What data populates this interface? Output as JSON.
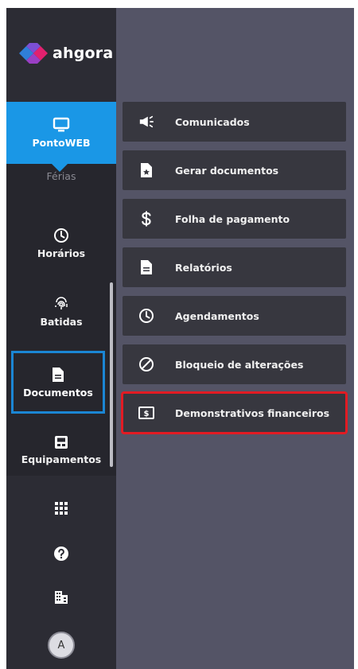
{
  "brand": {
    "name": "ahgora"
  },
  "nav": {
    "items": [
      {
        "label": "PontoWEB",
        "icon": "monitor-icon",
        "state": "active"
      },
      {
        "label": "Férias",
        "icon": "vacation-icon",
        "state": "dim"
      },
      {
        "label": "Horários",
        "icon": "clock-icon",
        "state": "normal"
      },
      {
        "label": "Batidas",
        "icon": "fingerprint-icon",
        "state": "normal"
      },
      {
        "label": "Documentos",
        "icon": "document-icon",
        "state": "focused"
      },
      {
        "label": "Equipamentos",
        "icon": "device-icon",
        "state": "normal"
      }
    ],
    "bottom": {
      "apps_icon": "grid-icon",
      "help_icon": "help-icon",
      "company_icon": "building-icon",
      "avatar_initial": "A"
    }
  },
  "submenu": {
    "items": [
      {
        "label": "Comunicados",
        "icon": "megaphone-icon"
      },
      {
        "label": "Gerar documentos",
        "icon": "document-star-icon"
      },
      {
        "label": "Folha de pagamento",
        "icon": "dollar-icon"
      },
      {
        "label": "Relatórios",
        "icon": "report-icon"
      },
      {
        "label": "Agendamentos",
        "icon": "clock-icon"
      },
      {
        "label": "Bloqueio de alterações",
        "icon": "block-icon"
      },
      {
        "label": "Demonstrativos financeiros",
        "icon": "money-bill-icon",
        "highlighted": true
      }
    ]
  },
  "colors": {
    "rail": "#2c2c34",
    "active": "#1a97e6",
    "focus": "#1b86d4",
    "highlight": "#e21b23",
    "submenu_bg": "#37373f",
    "panel_bg": "#545466"
  }
}
